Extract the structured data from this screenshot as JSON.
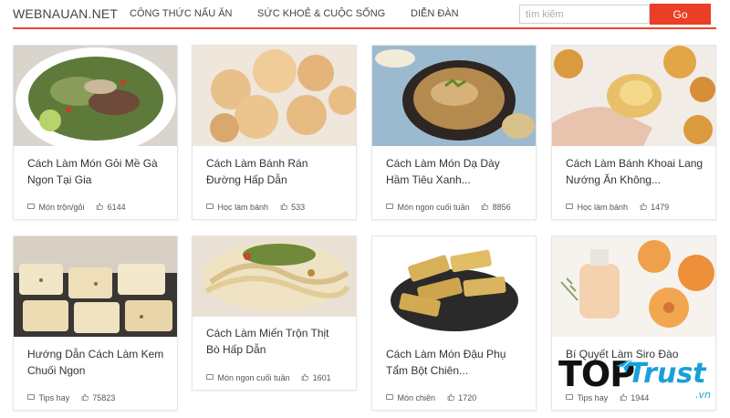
{
  "header": {
    "logo": "WEBNAUAN.NET",
    "nav": [
      "Công thức nấu ăn",
      "Sức khoẻ & Cuộc sống",
      "Diễn đàn"
    ],
    "search": {
      "placeholder": "tìm kiếm",
      "button": "Go"
    },
    "accent_color": "#e9472f"
  },
  "cards": [
    {
      "title": "Cách Làm Món Gỏi Mề Gà Ngon Tại Gia",
      "category": "Món trộn/gỏi",
      "likes": "6144",
      "icon": "food-photo"
    },
    {
      "title": "Cách Làm Bánh Rán Đường Hấp Dẫn",
      "category": "Học làm bánh",
      "likes": "533",
      "icon": "food-photo"
    },
    {
      "title": "Cách Làm Món Dạ Dày Hầm Tiêu Xanh...",
      "category": "Món ngon cuối tuần",
      "likes": "8856",
      "icon": "food-photo"
    },
    {
      "title": "Cách Làm Bánh Khoai Lang Nướng Ăn Không...",
      "category": "Học làm bánh",
      "likes": "1479",
      "icon": "food-photo"
    },
    {
      "title": "Hướng Dẫn Cách Làm Kem Chuối Ngon",
      "category": "Tips hay",
      "likes": "75823",
      "icon": "food-photo"
    },
    {
      "title": "Cách Làm Miến Trộn Thịt Bò Hấp Dẫn",
      "category": "Món ngon cuối tuần",
      "likes": "1601",
      "icon": "food-photo"
    },
    {
      "title": "Cách Làm Món Đậu Phụ Tẩm Bột Chiên...",
      "category": "Món chiên",
      "likes": "1720",
      "icon": "food-photo"
    },
    {
      "title": "Bí Quyết Làm Siro Đào",
      "category": "Tips hay",
      "likes": "1944",
      "icon": "food-photo"
    }
  ],
  "watermark": {
    "brand": "TOP",
    "brand2": "Trust",
    "tld": ".vn"
  }
}
